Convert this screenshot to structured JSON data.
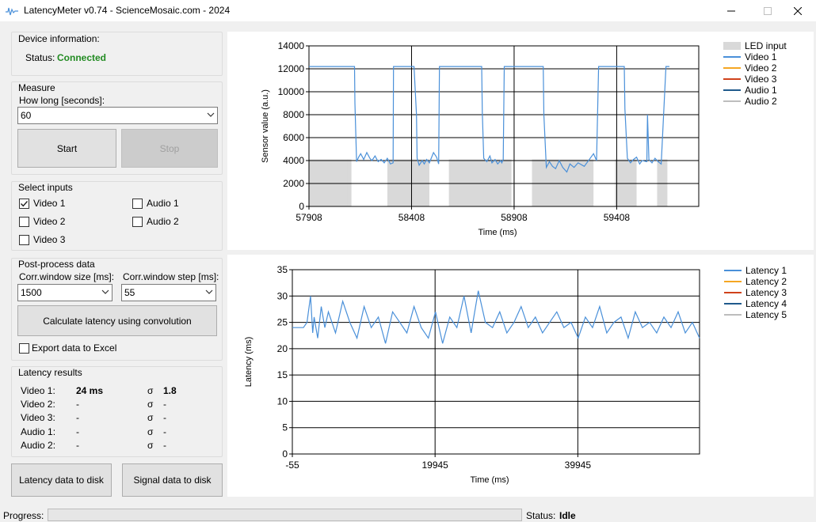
{
  "window": {
    "title": "LatencyMeter v0.74 - ScienceMosaic.com - 2024"
  },
  "device": {
    "legend": "Device information:",
    "status_label": "Status:",
    "status_value": "Connected",
    "status_color": "#228b22"
  },
  "measure": {
    "legend": "Measure",
    "how_long_label": "How long [seconds]:",
    "how_long_value": "60",
    "start_label": "Start",
    "stop_label": "Stop"
  },
  "inputs": {
    "legend": "Select inputs",
    "items": [
      {
        "label": "Video 1",
        "checked": true
      },
      {
        "label": "Audio 1",
        "checked": false
      },
      {
        "label": "Video 2",
        "checked": false
      },
      {
        "label": "Audio 2",
        "checked": false
      },
      {
        "label": "Video 3",
        "checked": false
      }
    ]
  },
  "postprocess": {
    "legend": "Post-process data",
    "window_size_label": "Corr.window size [ms]:",
    "window_size_value": "1500",
    "window_step_label": "Corr.window step [ms]:",
    "window_step_value": "55",
    "calc_label": "Calculate latency using convolution",
    "export_label": "Export data to Excel",
    "export_checked": false
  },
  "results": {
    "legend": "Latency results",
    "sigma": "σ",
    "rows": [
      {
        "name": "Video 1:",
        "value": "24 ms",
        "sigma": "1.8"
      },
      {
        "name": "Video 2:",
        "value": "-",
        "sigma": "-"
      },
      {
        "name": "Video 3:",
        "value": "-",
        "sigma": "-"
      },
      {
        "name": "Audio 1:",
        "value": "-",
        "sigma": "-"
      },
      {
        "name": "Audio 2:",
        "value": "-",
        "sigma": "-"
      }
    ]
  },
  "buttons": {
    "latency_disk": "Latency data to disk",
    "signal_disk": "Signal data to disk"
  },
  "statusbar": {
    "progress_label": "Progress:",
    "progress_value": 0,
    "status_label": "Status:",
    "status_value": "Idle"
  },
  "chart_data": [
    {
      "type": "line",
      "xlabel": "Time (ms)",
      "ylabel": "Sensor value (a.u.)",
      "xlim": [
        57908,
        59808
      ],
      "ylim": [
        0,
        14000
      ],
      "x_ticks": [
        "57908",
        "58408",
        "58908",
        "59408"
      ],
      "y_ticks": [
        "0",
        "2000",
        "4000",
        "6000",
        "8000",
        "10000",
        "12000",
        "14000"
      ],
      "grid": true,
      "legend_position": "right",
      "legend": [
        {
          "name": "LED input",
          "color": "#d9d9d9",
          "kind": "area"
        },
        {
          "name": "Video 1",
          "color": "#4a90d9",
          "kind": "line"
        },
        {
          "name": "Video 2",
          "color": "#f5a623",
          "kind": "line"
        },
        {
          "name": "Video 3",
          "color": "#d0421b",
          "kind": "line"
        },
        {
          "name": "Audio 1",
          "color": "#1f5a8c",
          "kind": "line"
        },
        {
          "name": "Audio 2",
          "color": "#bdbdbd",
          "kind": "line"
        }
      ],
      "led_on_intervals": [
        [
          57908,
          58115
        ],
        [
          58095,
          58100
        ],
        [
          58290,
          58495
        ],
        [
          58590,
          58895
        ],
        [
          58995,
          59295
        ],
        [
          59400,
          59505
        ],
        [
          59605,
          59655
        ]
      ],
      "series": [
        {
          "name": "Video 1",
          "x": [
            57908,
            58130,
            58132,
            58140,
            58150,
            58160,
            58175,
            58190,
            58205,
            58215,
            58230,
            58245,
            58260,
            58275,
            58290,
            58305,
            58318,
            58320,
            58420,
            58432,
            58435,
            58445,
            58460,
            58470,
            58482,
            58495,
            58515,
            58530,
            58540,
            58544,
            58750,
            58753,
            58760,
            58775,
            58790,
            58800,
            58815,
            58828,
            58843,
            58848,
            58855,
            58860,
            59050,
            59053,
            59065,
            59080,
            59095,
            59110,
            59128,
            59145,
            59165,
            59180,
            59200,
            59220,
            59250,
            59295,
            59310,
            59320,
            59445,
            59448,
            59460,
            59475,
            59490,
            59505,
            59520,
            59532,
            59555,
            59558,
            59565,
            59580,
            59595,
            59610,
            59625,
            59648,
            59655,
            59665
          ],
          "y": [
            12200,
            12200,
            9000,
            3900,
            4300,
            4600,
            4100,
            4700,
            4200,
            4000,
            4400,
            3900,
            4100,
            3800,
            4200,
            3700,
            3800,
            12200,
            12200,
            8000,
            4200,
            3600,
            4000,
            3700,
            4100,
            3800,
            4700,
            4300,
            3700,
            12200,
            12200,
            8200,
            4200,
            3900,
            4400,
            3800,
            4100,
            3700,
            4000,
            3800,
            4100,
            12200,
            12200,
            8000,
            3400,
            3900,
            3500,
            3300,
            4000,
            3400,
            3000,
            3700,
            3400,
            3800,
            3500,
            4600,
            4000,
            12200,
            12200,
            8500,
            4200,
            3800,
            4100,
            4300,
            3700,
            4000,
            3900,
            8000,
            4100,
            3800,
            4200,
            3900,
            3700,
            12200,
            12200,
            12200
          ]
        }
      ]
    },
    {
      "type": "line",
      "xlabel": "Time (ms)",
      "ylabel": "Latency (ms)",
      "xlim": [
        -55,
        57000
      ],
      "ylim": [
        0,
        35
      ],
      "x_ticks": [
        "-55",
        "19945",
        "39945"
      ],
      "y_ticks": [
        "0",
        "5",
        "10",
        "15",
        "20",
        "25",
        "30",
        "35"
      ],
      "grid": true,
      "legend_position": "right",
      "legend": [
        {
          "name": "Latency 1",
          "color": "#4a90d9"
        },
        {
          "name": "Latency 2",
          "color": "#f5a623"
        },
        {
          "name": "Latency 3",
          "color": "#d0421b"
        },
        {
          "name": "Latency 4",
          "color": "#1f5a8c"
        },
        {
          "name": "Latency 5",
          "color": "#bdbdbd"
        }
      ],
      "series": [
        {
          "name": "Latency 1",
          "x": [
            -55,
            1500,
            2000,
            2500,
            2800,
            3000,
            3500,
            4000,
            4500,
            5000,
            6000,
            7000,
            8000,
            9000,
            10000,
            11000,
            12000,
            13000,
            14000,
            15000,
            16000,
            17000,
            18000,
            19000,
            20000,
            21000,
            22000,
            23000,
            24000,
            25000,
            26000,
            27000,
            28000,
            29000,
            30000,
            31000,
            32000,
            33000,
            34000,
            35000,
            36000,
            37000,
            38000,
            39000,
            40000,
            41000,
            42000,
            43000,
            44000,
            45000,
            46000,
            47000,
            48000,
            49000,
            50000,
            51000,
            52000,
            53000,
            54000,
            55000,
            56000,
            57000
          ],
          "y": [
            24,
            24,
            25,
            30,
            23,
            26,
            22,
            28,
            24,
            27,
            23,
            29,
            25,
            22,
            28,
            24,
            26,
            21,
            27,
            25,
            23,
            28,
            24,
            22,
            27,
            21,
            26,
            24,
            30,
            23,
            31,
            25,
            24,
            27,
            23,
            25,
            28,
            24,
            26,
            23,
            25,
            27,
            24,
            25,
            22,
            26,
            24,
            28,
            23,
            25,
            26,
            22,
            27,
            24,
            25,
            23,
            26,
            24,
            27,
            23,
            25,
            22
          ]
        }
      ]
    }
  ]
}
